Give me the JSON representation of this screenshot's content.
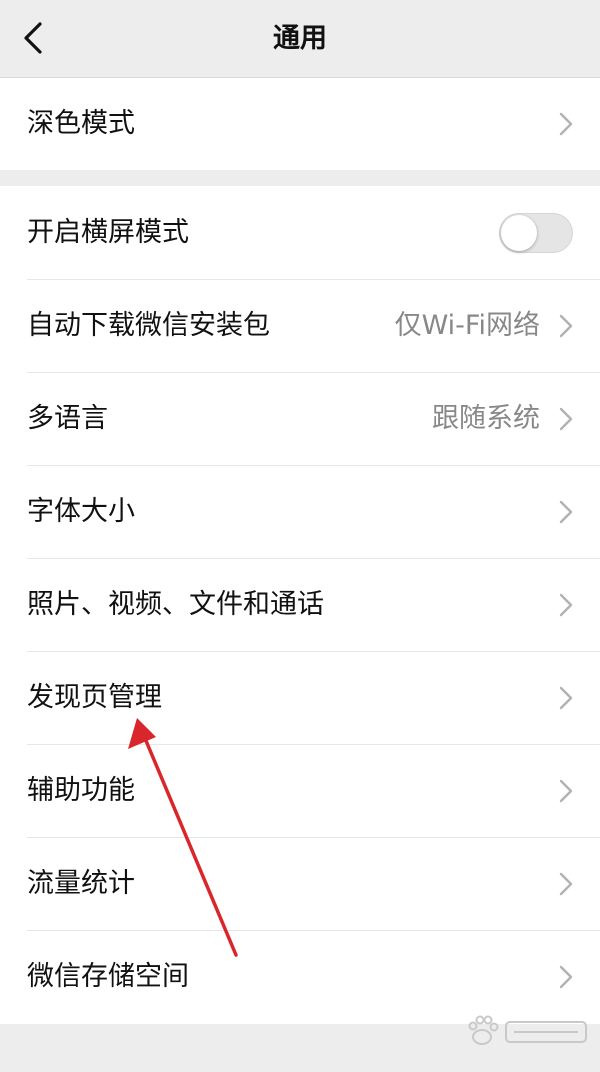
{
  "navbar": {
    "title": "通用"
  },
  "groups": [
    {
      "items": [
        {
          "label": "深色模式"
        }
      ]
    },
    {
      "items": [
        {
          "label": "开启横屏模式",
          "toggle_on": false
        },
        {
          "label": "自动下载微信安装包",
          "value": "仅Wi-Fi网络"
        },
        {
          "label": "多语言",
          "value": "跟随系统"
        },
        {
          "label": "字体大小"
        },
        {
          "label": "照片、视频、文件和通话"
        },
        {
          "label": "发现页管理"
        },
        {
          "label": "辅助功能"
        },
        {
          "label": "流量统计"
        },
        {
          "label": "微信存储空间"
        }
      ]
    }
  ],
  "colors": {
    "background": "#ededed",
    "annotation_arrow": "#d9262b",
    "toggle_off": "#e5e5e5"
  },
  "icons": {
    "back": "chevron-left-icon",
    "row": "chevron-right-icon",
    "watermark": "baidu-paw-logo"
  }
}
